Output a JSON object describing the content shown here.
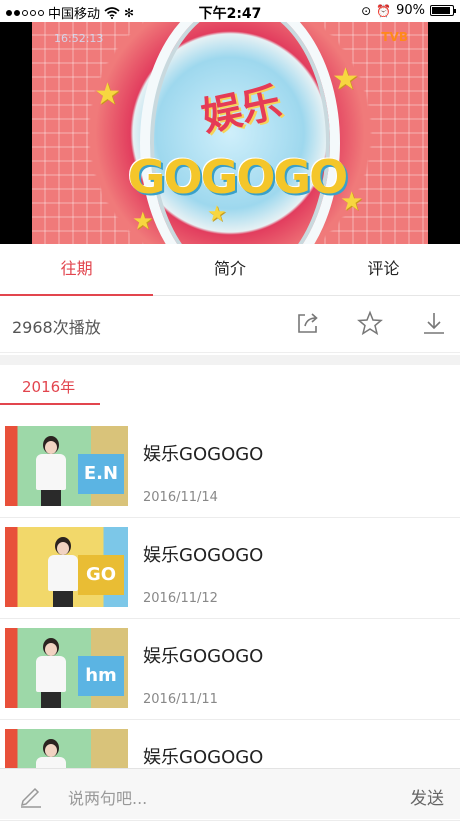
{
  "status_bar": {
    "carrier": "中国移动",
    "time": "下午2:47",
    "battery": "90%",
    "battery_level": 0.9
  },
  "video": {
    "timecode": "16:52:13",
    "channel": "TVB",
    "logo_text": "GOGOGO",
    "logo_cn": "娱乐"
  },
  "tabs": [
    {
      "label": "往期",
      "active": true
    },
    {
      "label": "简介",
      "active": false
    },
    {
      "label": "评论",
      "active": false
    }
  ],
  "play_count": "2968次播放",
  "actions": {
    "share": "share-icon",
    "favorite": "star-icon",
    "download": "download-icon"
  },
  "year_tab": "2016年",
  "episodes": [
    {
      "title": "娱乐GOGOGO",
      "date": "2016/11/14",
      "thumb_sign": "E.N"
    },
    {
      "title": "娱乐GOGOGO",
      "date": "2016/11/12",
      "thumb_sign": "GO"
    },
    {
      "title": "娱乐GOGOGO",
      "date": "2016/11/11",
      "thumb_sign": "hm"
    },
    {
      "title": "娱乐GOGOGO",
      "date": "",
      "thumb_sign": ""
    }
  ],
  "comment_bar": {
    "placeholder": "说两句吧...",
    "send_label": "发送"
  },
  "colors": {
    "accent": "#e2454e",
    "text": "#222222",
    "muted": "#888888"
  }
}
